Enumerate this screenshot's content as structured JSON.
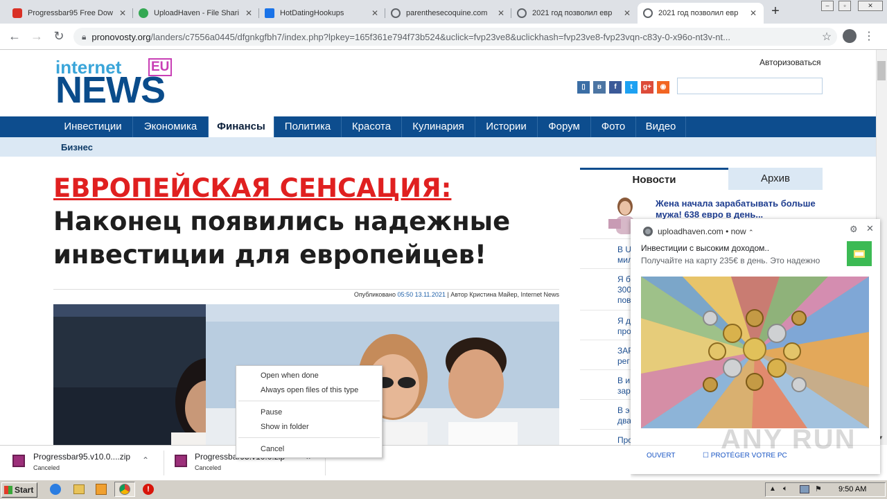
{
  "browser": {
    "tabs": [
      {
        "title": "Progressbar95 Free Dow",
        "favicon": "lock-icon",
        "color": "#d93025"
      },
      {
        "title": "UploadHaven - File Shari",
        "favicon": "uploadhaven-icon",
        "color": "#34a853"
      },
      {
        "title": "HotDatingHookups",
        "favicon": "h-logo-icon",
        "color": "#1a73e8"
      },
      {
        "title": "parenthesecoquine.com",
        "favicon": "globe-icon",
        "color": "#5f6368"
      },
      {
        "title": "2021 год позволил евр",
        "favicon": "globe-icon",
        "color": "#5f6368"
      },
      {
        "title": "2021 год позволил евр",
        "favicon": "globe-icon",
        "color": "#5f6368"
      }
    ],
    "active_tab": 5,
    "url_host": "pronovosty.org",
    "url_path": "/landers/c7556a0445/dfgnkgfbh7/index.php?lpkey=165f361e794f73b524&uclick=fvp23ve8&uclickhash=fvp23ve8-fvp23vqn-c83y-0-x96o-nt3v-nt..."
  },
  "site": {
    "logo_top": "internet",
    "logo_eu": "EU",
    "logo_news": "NEWS",
    "login": "Авторизоваться",
    "social": [
      {
        "icon": "mobile-icon",
        "glyph": "▯",
        "color": "#3b6ea5"
      },
      {
        "icon": "vk-icon",
        "glyph": "в",
        "color": "#4c75a3"
      },
      {
        "icon": "facebook-icon",
        "glyph": "f",
        "color": "#3b5998"
      },
      {
        "icon": "twitter-icon",
        "glyph": "t",
        "color": "#1da1f2"
      },
      {
        "icon": "googleplus-icon",
        "glyph": "g+",
        "color": "#dd4b39"
      },
      {
        "icon": "rss-icon",
        "glyph": "◉",
        "color": "#f26522"
      }
    ],
    "menu": [
      "Инвестиции",
      "Экономика",
      "Финансы",
      "Политика",
      "Красота",
      "Кулинария",
      "Истории",
      "Форум",
      "Фото",
      "Видео"
    ],
    "menu_active": 2,
    "submenu": "Бизнес"
  },
  "article": {
    "headline_red": "ЕВРОПЕЙСКАЯ СЕНСАЦИЯ:",
    "headline_rest": " Наконец появились надежные инвестиции для европейцев!",
    "byline_prefix": "Опубликовано",
    "byline_time": "05:50 13.11.2021",
    "byline_suffix": "| Автор Кристина Майер, Internet News"
  },
  "sidebar": {
    "tab_news": "Новости",
    "tab_archive": "Архив",
    "featured": "Жена начала зарабатывать больше мужа! 638 евро в день...",
    "items": [
      "В U",
      "мил",
      "Я б",
      "300",
      "пов",
      "Я д",
      "про",
      "ЗАР",
      "рег",
      "В и",
      "зар",
      "В э",
      "два",
      "Про"
    ]
  },
  "notification": {
    "source": "uploadhaven.com",
    "time": "now",
    "title": "Инвестиции с высоким доходом..",
    "body": "Получайте на карту 235€ в день. Это надежно",
    "action_open": "OUVERT",
    "action_protect": "PROTÉGER VOTRE PC"
  },
  "context_menu": {
    "items": [
      "Open when done",
      "Always open files of this type",
      "Pause",
      "Show in folder",
      "Cancel"
    ]
  },
  "downloads": [
    {
      "name": "Progressbar95.v10.0....zip",
      "status": "Canceled"
    },
    {
      "name": "Progressbar95.v10.0.zip",
      "status": "Canceled"
    }
  ],
  "watermark": "ANY RUN",
  "taskbar": {
    "start": "Start",
    "clock": "9:50 AM"
  }
}
